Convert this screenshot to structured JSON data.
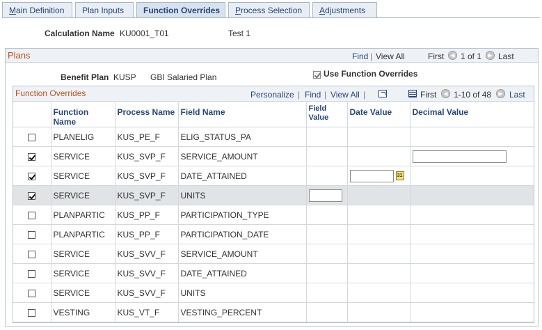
{
  "tabs": [
    {
      "label": "Main Definition",
      "u": "M",
      "rest": "ain Definition"
    },
    {
      "label": "Plan Inputs"
    },
    {
      "label": "Function Overrides"
    },
    {
      "label": "Process Selection",
      "u": "P",
      "rest": "rocess Selection"
    },
    {
      "label": "Adjustments",
      "u": "A",
      "rest": "djustments"
    }
  ],
  "header": {
    "calc_label": "Calculation Name",
    "calc_value": "KU0001_T01",
    "calc_desc": "Test 1"
  },
  "plans": {
    "title": "Plans",
    "find": "Find",
    "view_all": "View All",
    "first": "First",
    "count": "1 of 1",
    "last": "Last",
    "benefit_plan_label": "Benefit Plan",
    "benefit_plan_value": "KUSP",
    "benefit_plan_desc": "GBI Salaried Plan",
    "use_overrides_label": "Use Function Overrides",
    "use_overrides_checked": true
  },
  "overrides": {
    "title": "Function Overrides",
    "personalize": "Personalize",
    "find": "Find",
    "view_all": "View All",
    "first": "First",
    "count": "1-10 of 48",
    "last": "Last",
    "columns": {
      "function_name": "Function Name",
      "process_name": "Process Name",
      "field_name": "Field Name",
      "field_value_1": "Field",
      "field_value_2": "Value",
      "date_value": "Date Value",
      "decimal_value": "Decimal Value"
    },
    "calendar_glyph": "31",
    "rows": [
      {
        "checked": false,
        "function": "PLANELIG",
        "process": "KUS_PE_F",
        "field": "ELIG_STATUS_PA",
        "input": ""
      },
      {
        "checked": true,
        "function": "SERVICE",
        "process": "KUS_SVP_F",
        "field": "SERVICE_AMOUNT",
        "input": "decimal"
      },
      {
        "checked": true,
        "function": "SERVICE",
        "process": "KUS_SVP_F",
        "field": "DATE_ATTAINED",
        "input": "date"
      },
      {
        "checked": true,
        "function": "SERVICE",
        "process": "KUS_SVP_F",
        "field": "UNITS",
        "input": "field"
      },
      {
        "checked": false,
        "function": "PLANPARTIC",
        "process": "KUS_PP_F",
        "field": "PARTICIPATION_TYPE",
        "input": ""
      },
      {
        "checked": false,
        "function": "PLANPARTIC",
        "process": "KUS_PP_F",
        "field": "PARTICIPATION_DATE",
        "input": ""
      },
      {
        "checked": false,
        "function": "SERVICE",
        "process": "KUS_SVV_F",
        "field": "SERVICE_AMOUNT",
        "input": ""
      },
      {
        "checked": false,
        "function": "SERVICE",
        "process": "KUS_SVV_F",
        "field": "DATE_ATTAINED",
        "input": ""
      },
      {
        "checked": false,
        "function": "SERVICE",
        "process": "KUS_SVV_F",
        "field": "UNITS",
        "input": ""
      },
      {
        "checked": false,
        "function": "VESTING",
        "process": "KUS_VT_F",
        "field": "VESTING_PERCENT",
        "input": ""
      }
    ]
  }
}
